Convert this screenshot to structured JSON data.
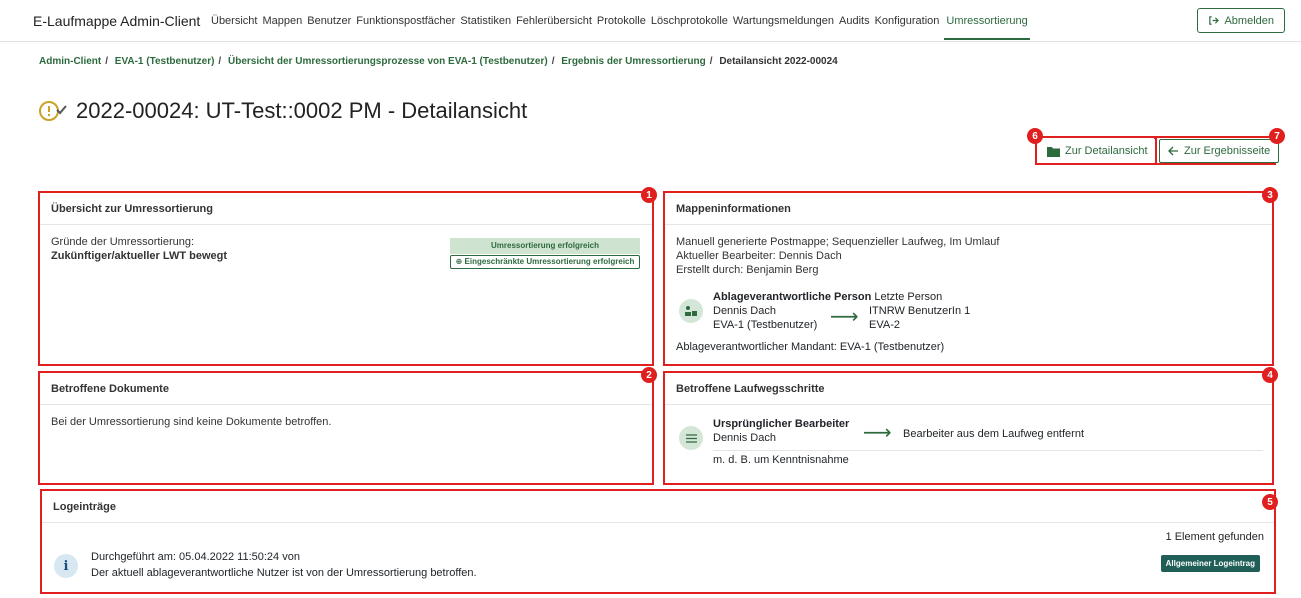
{
  "app": {
    "brand": "E-Laufmappe Admin-Client",
    "nav": [
      "Übersicht",
      "Mappen",
      "Benutzer",
      "Funktionspostfächer",
      "Statistiken",
      "Fehlerübersicht",
      "Protokolle",
      "Löschprotokolle",
      "Wartungsmeldungen",
      "Audits",
      "Konfiguration",
      "Umressortierung"
    ],
    "active_nav": "Umressortierung",
    "logout_label": "Abmelden"
  },
  "breadcrumb": {
    "items": [
      "Admin-Client",
      "EVA-1 (Testbenutzer)",
      "Übersicht der Umressortierungsprozesse von EVA-1 (Testbenutzer)",
      "Ergebnis der Umressortierung"
    ],
    "current": "Detailansicht 2022-00024"
  },
  "page": {
    "title": "2022-00024: UT-Test::0002 PM - Detailansicht",
    "btn_detail": "Zur Detailansicht",
    "btn_results": "Zur Ergebnisseite"
  },
  "markers": [
    "1",
    "2",
    "3",
    "4",
    "5",
    "6",
    "7"
  ],
  "overview": {
    "title": "Übersicht zur Umressortierung",
    "reasons_label": "Gründe der Umressortierung:",
    "reasons_value": "Zukünftiger/aktueller LWT bewegt",
    "status_success": "Umressortierung erfolgreich",
    "status_limited": "Eingeschränkte Umressortierung erfolgreich"
  },
  "mappe": {
    "title": "Mappeninformationen",
    "line1": "Manuell generierte Postmappe; Sequenzieller Laufweg, Im Umlauf",
    "line2": "Aktueller Bearbeiter: Dennis Dach",
    "line3": "Erstellt durch: Benjamin Berg",
    "resp_label": "Ablageverantwortliche Person",
    "last_label": "Letzte Person",
    "from_name": "Dennis Dach",
    "from_org": "EVA-1 (Testbenutzer)",
    "to_name": "ITNRW BenutzerIn 1",
    "to_org": "EVA-2",
    "mandant": "Ablageverantwortlicher Mandant: EVA-1 (Testbenutzer)"
  },
  "documents": {
    "title": "Betroffene Dokumente",
    "text": "Bei der Umressortierung sind keine Dokumente betroffen."
  },
  "steps": {
    "title": "Betroffene Laufwegsschritte",
    "label": "Ursprünglicher Bearbeiter",
    "name": "Dennis Dach",
    "result": "Bearbeiter aus dem Laufweg entfernt",
    "sub": "m. d. B. um Kenntnisnahme"
  },
  "logs": {
    "title": "Logeinträge",
    "count": "1 Element gefunden",
    "entry_line1": "Durchgeführt am: 05.04.2022 11:50:24 von",
    "entry_line2": "Der aktuell ablageverantwortliche Nutzer ist von der Umressortierung betroffen.",
    "badge": "Allgemeiner Logeintrag"
  }
}
